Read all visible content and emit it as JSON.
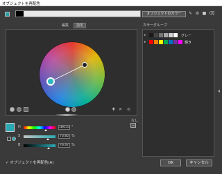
{
  "window": {
    "title": "オブジェクトを再配色"
  },
  "toolbar": {
    "object_colors_label": "オブジェクトのカラー",
    "icons": [
      "eyedropper-icon",
      "settings-icon",
      "folder-icon",
      "trash-icon"
    ]
  },
  "tabs": [
    {
      "label": "編集",
      "active": true
    },
    {
      "label": "指定",
      "active": false
    }
  ],
  "color_panel": {
    "base_color": "#2ba9b3",
    "hsb": [
      {
        "label": "H",
        "value": "184.53",
        "unit": "°"
      },
      {
        "label": "S",
        "value": "73.85",
        "unit": "%"
      },
      {
        "label": "B",
        "value": "76.47",
        "unit": "%"
      }
    ],
    "none_label": "なし"
  },
  "color_groups": {
    "title": "カラーグループ",
    "groups": [
      {
        "name": "グレー",
        "swatches": [
          "#1a1a1a",
          "#444444",
          "#777777",
          "#a9a9a9",
          "#d2d2d2",
          "#ffffff"
        ]
      },
      {
        "name": "輝き",
        "swatches": [
          "#ff0000",
          "#ff7f00",
          "#ffff00",
          "#00a650",
          "#0070c0",
          "#7030a0",
          "#ff00ff"
        ]
      }
    ]
  },
  "footer": {
    "recolor_label": "オブジェクトを再配色(A)",
    "recolor_checked": true,
    "ok_label": "OK",
    "cancel_label": "キャンセル"
  }
}
